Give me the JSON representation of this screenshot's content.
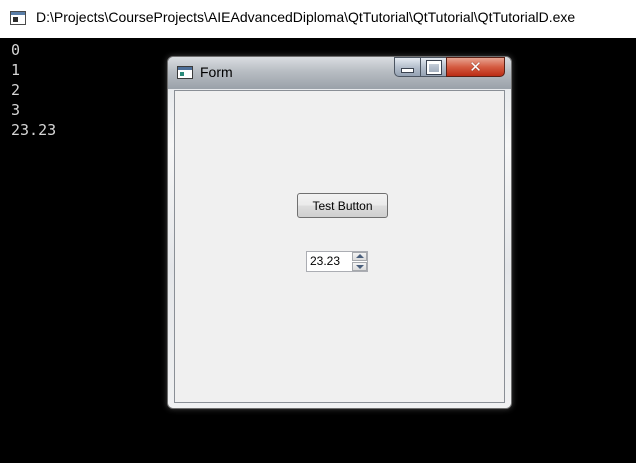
{
  "console": {
    "title": "D:\\Projects\\CourseProjects\\AIEAdvancedDiploma\\QtTutorial\\QtTutorial\\QtTutorialD.exe",
    "icon": "console-app-icon",
    "output_lines": [
      "0",
      "1",
      "2",
      "3",
      "23.23"
    ],
    "text_color": "#d6d6d6",
    "background_color": "#000000"
  },
  "form": {
    "title": "Form",
    "icon": "qt-form-icon",
    "caption_buttons": {
      "minimize": "minimize-icon",
      "maximize": "maximize-icon",
      "close": "close-icon",
      "close_color": "#c8452d"
    },
    "test_button_label": "Test Button",
    "spin_box": {
      "value": "23.23"
    }
  }
}
